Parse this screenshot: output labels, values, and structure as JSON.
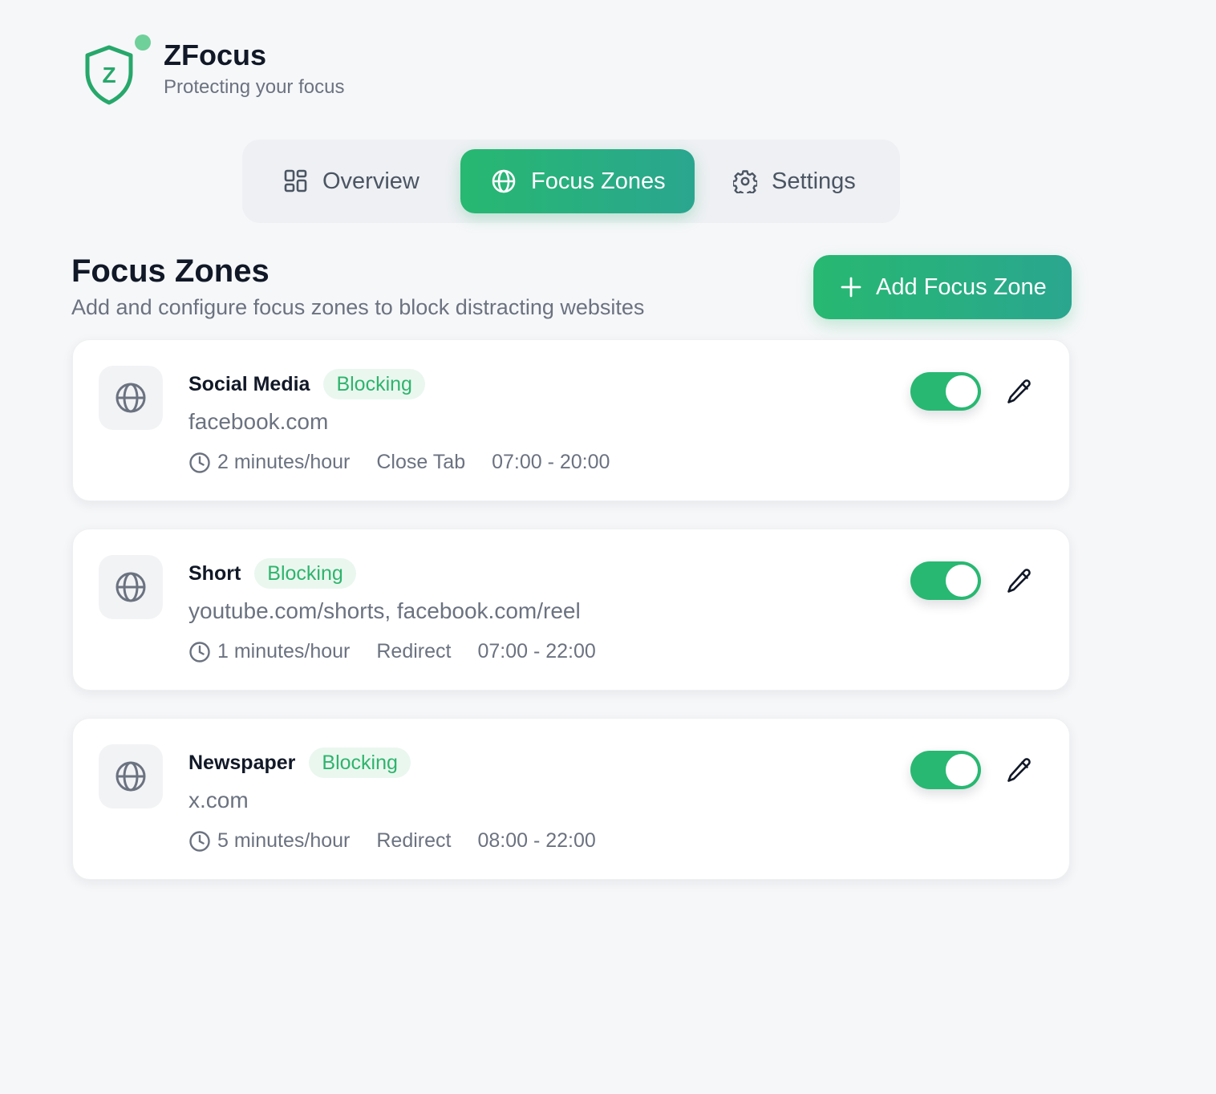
{
  "app": {
    "title": "ZFocus",
    "subtitle": "Protecting your focus",
    "logo_letter": "Z",
    "accent_color": "#27b871"
  },
  "tabs": [
    {
      "label": "Overview",
      "icon": "grid-icon",
      "active": false
    },
    {
      "label": "Focus Zones",
      "icon": "globe-icon",
      "active": true
    },
    {
      "label": "Settings",
      "icon": "gear-icon",
      "active": false
    }
  ],
  "section": {
    "title": "Focus Zones",
    "subtitle": "Add and configure focus zones to block distracting websites",
    "add_button_label": "Add Focus Zone"
  },
  "zones": [
    {
      "name": "Social Media",
      "status": "Blocking",
      "domains": "facebook.com",
      "limit": "2 minutes/hour",
      "action": "Close Tab",
      "hours": "07:00 - 20:00",
      "enabled": true
    },
    {
      "name": "Short",
      "status": "Blocking",
      "domains": "youtube.com/shorts, facebook.com/reel",
      "limit": "1 minutes/hour",
      "action": "Redirect",
      "hours": "07:00 - 22:00",
      "enabled": true
    },
    {
      "name": "Newspaper",
      "status": "Blocking",
      "domains": "x.com",
      "limit": "5 minutes/hour",
      "action": "Redirect",
      "hours": "08:00 - 22:00",
      "enabled": true
    }
  ]
}
